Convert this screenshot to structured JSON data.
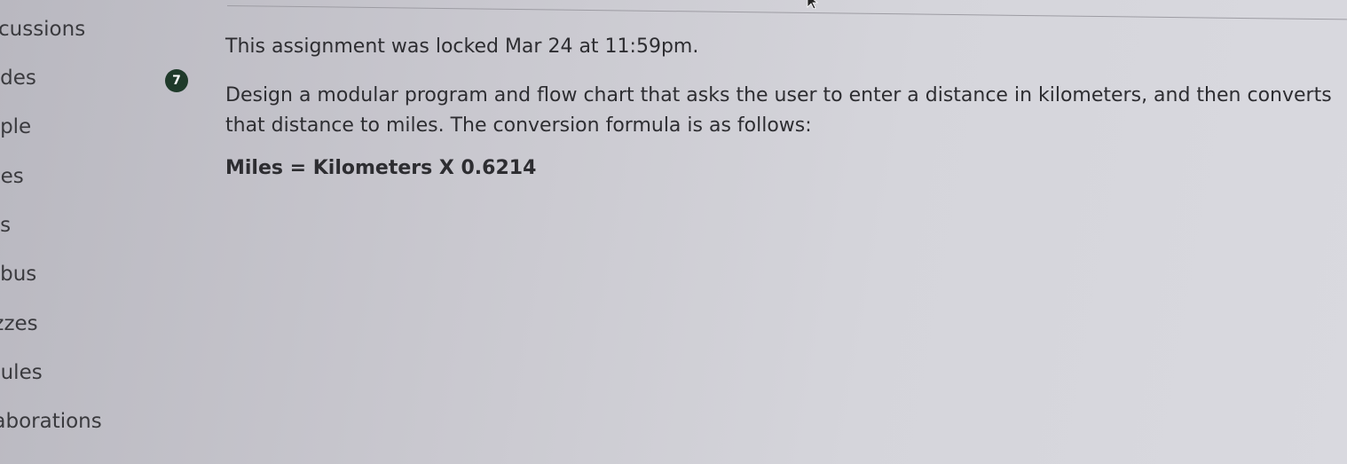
{
  "nav": {
    "items": [
      {
        "label": "scussions"
      },
      {
        "label": "ades"
      },
      {
        "label": "ople"
      },
      {
        "label": "ges"
      },
      {
        "label": "es"
      },
      {
        "label": "abus"
      },
      {
        "label": "izzes"
      },
      {
        "label": "dules"
      },
      {
        "label": "laborations"
      }
    ]
  },
  "badge": {
    "count": "7"
  },
  "assignment": {
    "locked_message": "This assignment was locked Mar 24 at 11:59pm.",
    "description": "Design a modular program and flow chart that asks the user to enter a distance in kilometers, and then converts that distance to miles. The conversion formula is as follows:",
    "formula": "Miles = Kilometers X 0.6214"
  },
  "colors": {
    "badge_bg": "#1f3a2a",
    "text": "#2d2d31",
    "background": "#cfcfd5"
  },
  "icons": {
    "cursor": "mouse-pointer-icon"
  }
}
